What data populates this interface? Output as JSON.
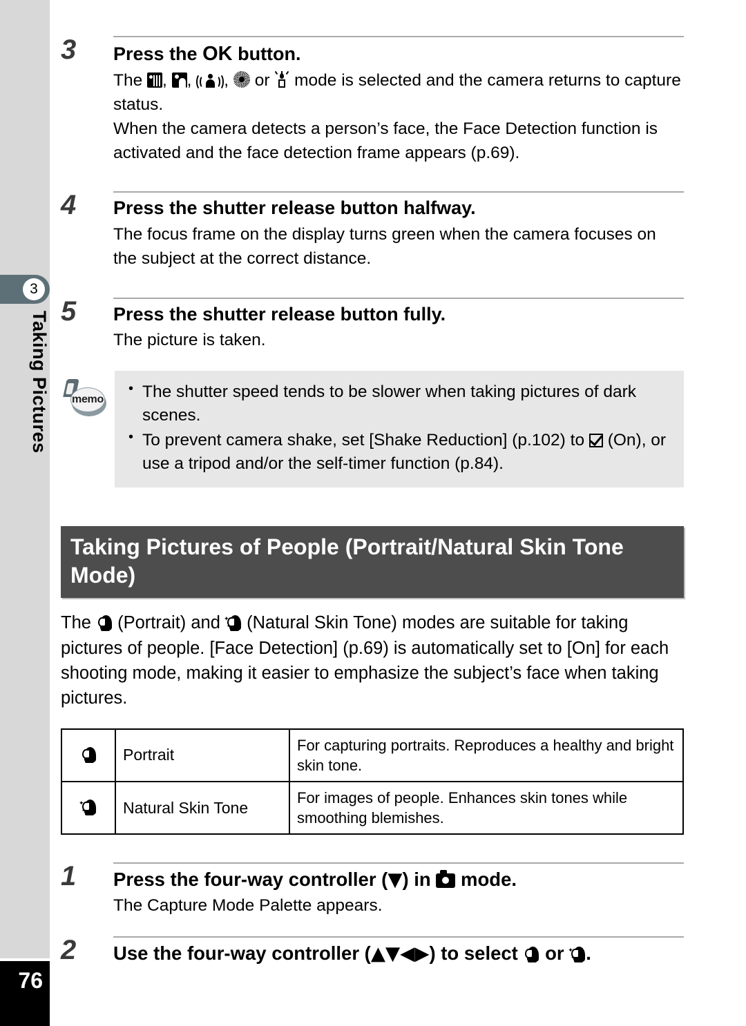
{
  "sidebar": {
    "chapter_number": "3",
    "chapter_title": "Taking Pictures",
    "page_number": "76"
  },
  "steps_top": [
    {
      "number": "3",
      "title_before": "Press the ",
      "title_ok": "OK",
      "title_after": " button.",
      "paragraphs": [
        {
          "segments": [
            {
              "type": "text",
              "text": "The "
            },
            {
              "type": "icon",
              "name": "night-scene-icon"
            },
            {
              "type": "text",
              "text": ", "
            },
            {
              "type": "icon",
              "name": "night-scene-portrait-icon"
            },
            {
              "type": "text",
              "text": ", "
            },
            {
              "type": "icon",
              "name": "moving-object-icon"
            },
            {
              "type": "text",
              "text": ", "
            },
            {
              "type": "icon",
              "name": "fireworks-icon"
            },
            {
              "type": "text",
              "text": " or "
            },
            {
              "type": "icon",
              "name": "candlelight-icon"
            },
            {
              "type": "text",
              "text": " mode is selected and the camera returns to capture status."
            }
          ],
          "plain": "The mode is selected and the camera returns to capture status."
        },
        {
          "plain": "When the camera detects a person’s face, the Face Detection function is activated and the face detection frame appears (p.69)."
        }
      ]
    },
    {
      "number": "4",
      "title": "Press the shutter release button halfway.",
      "text": "The focus frame on the display turns green when the camera focuses on the subject at the correct distance."
    },
    {
      "number": "5",
      "title": "Press the shutter release button fully.",
      "text": "The picture is taken."
    }
  ],
  "memo": {
    "icon_label": "memo",
    "items": [
      {
        "text": "The shutter speed tends to be slower when taking pictures of dark scenes."
      },
      {
        "before": "To prevent camera shake, set [Shake Reduction] (p.102) to ",
        "icon": "checkbox-on-icon",
        "after": " (On), or use a tripod and/or the self-timer function (p.84)."
      }
    ]
  },
  "section": {
    "heading": "Taking Pictures of People (Portrait/Natural Skin Tone Mode)",
    "intro_part1": "The ",
    "intro_part2": " (Portrait) and ",
    "intro_part3": " (Natural Skin Tone) modes are suitable for taking pictures of people. [Face Detection] (p.69) is automatically set to [On] for each shooting mode, making it easier to emphasize the subject’s face when taking pictures."
  },
  "mode_table": {
    "rows": [
      {
        "icon": "portrait-icon",
        "name": "Portrait",
        "description": "For capturing portraits. Reproduces a healthy and bright skin tone."
      },
      {
        "icon": "natural-skin-tone-icon",
        "name": "Natural Skin Tone",
        "description": "For images of people. Enhances skin tones while smoothing blemishes."
      }
    ]
  },
  "steps_bottom": [
    {
      "number": "1",
      "title_part1": "Press the four-way controller (",
      "arrow_down": "▼",
      "title_part2": ") in ",
      "title_part3": " mode.",
      "text": "The Capture Mode Palette appears."
    },
    {
      "number": "2",
      "title_part1": "Use the four-way controller (",
      "arrow_up": "▲",
      "arrow_down": "▼",
      "arrow_left": "◀",
      "arrow_right": "▶",
      "title_part2": ") to select ",
      "title_part3": " or ",
      "title_part4": "."
    }
  ],
  "colors": {
    "sidebar_bg": "#d8d8d8",
    "chapter_tab": "#5e7077",
    "section_header_bg": "#4d4d4d",
    "memo_bg": "#e7e7e7",
    "page_number_bg": "#000000"
  }
}
